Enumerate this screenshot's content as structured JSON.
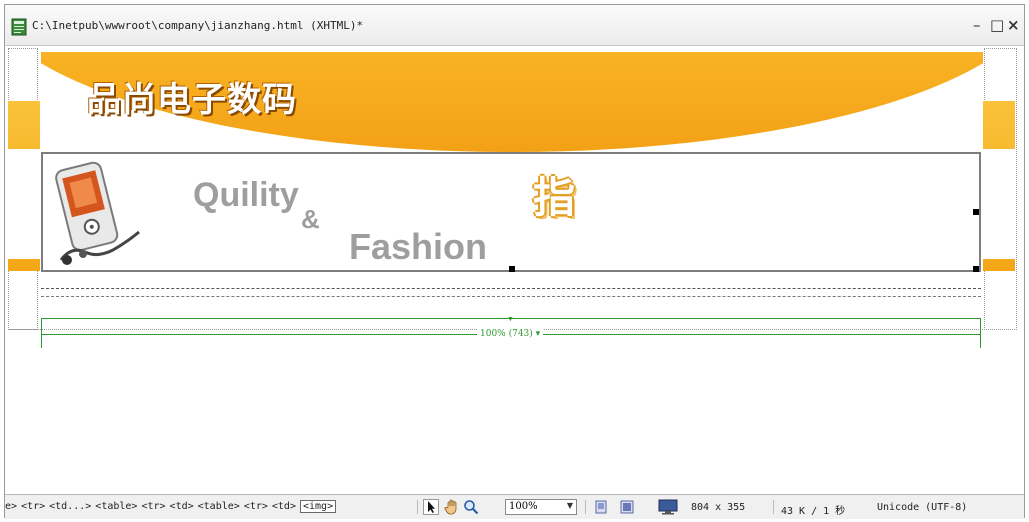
{
  "window": {
    "title": "C:\\Inetpub\\wwwroot\\company\\jianzhang.html (XHTML)*",
    "controls": {
      "minimize": "–",
      "maximize": "□",
      "close": "×"
    }
  },
  "design": {
    "logo_text": "品尚电子数码",
    "slogan": {
      "line1": "Quility",
      "ampersand": "&",
      "line2": "Fashion"
    },
    "decor_char": "指",
    "width_indicator": "100% (743) ▾"
  },
  "statusbar": {
    "tag_path": [
      "e>",
      "<tr>",
      "<td...>",
      "<table>",
      "<tr>",
      "<td>",
      "<table>",
      "<tr>",
      "<td>"
    ],
    "selected_tag": "<img>",
    "zoom": "100%",
    "window_size": "804 x 355",
    "download_info": "43 K / 1 秒",
    "encoding": "Unicode (UTF-8)"
  },
  "icons": [
    "document-icon",
    "select-tool-icon",
    "hand-tool-icon",
    "zoom-tool-icon",
    "panel-icon",
    "panel-icon-2",
    "monitor-icon"
  ],
  "colors": {
    "banner_orange": "#f6a00f",
    "indicator_green": "#2e9a2e"
  }
}
